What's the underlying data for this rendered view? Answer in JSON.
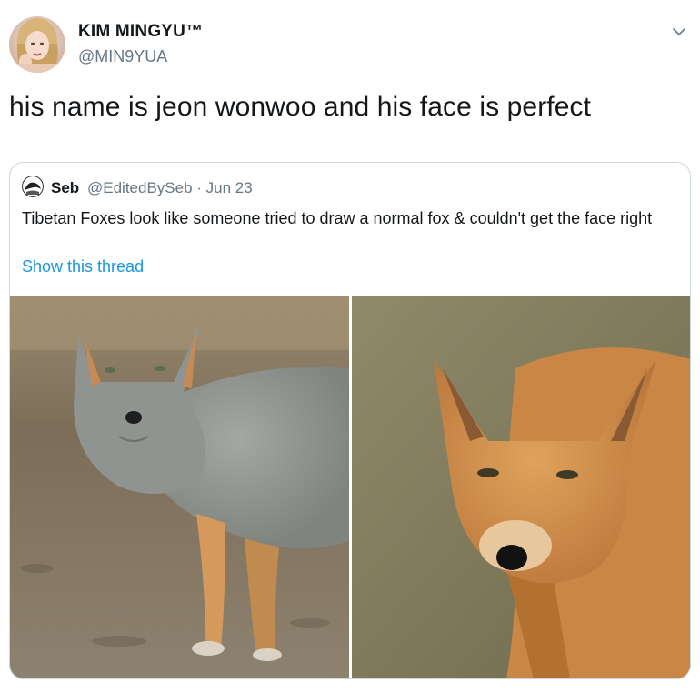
{
  "tweet": {
    "author": {
      "display_name": "KIM MINGYU™",
      "handle": "@MIN9YUA",
      "avatar_icon": "profile-photo"
    },
    "menu_icon": "chevron-down-icon",
    "text": "his name is jeon wonwoo and his face is perfect"
  },
  "quote": {
    "author": {
      "display_name": "Seb",
      "meta": "@EditedBySeb · Jun 23",
      "avatar_icon": "profile-photo"
    },
    "text": "Tibetan Foxes look like someone tried to draw a normal fox & couldn't get the face right",
    "show_thread_label": "Show this thread",
    "media": [
      {
        "description_icon": "grey-fox-photo"
      },
      {
        "description_icon": "orange-fox-photo"
      }
    ]
  },
  "colors": {
    "text_primary": "#14171a",
    "text_secondary": "#657786",
    "link": "#1b95e0",
    "border": "#ccd6dd"
  }
}
